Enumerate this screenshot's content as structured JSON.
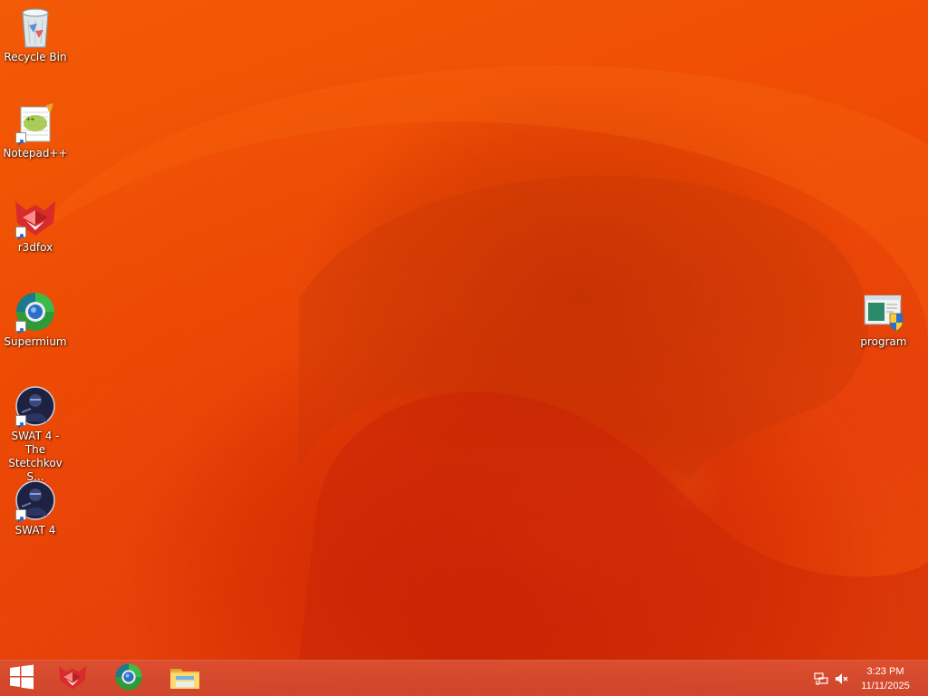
{
  "desktop": {
    "icons": [
      {
        "label": "Recycle Bin",
        "icon": "recycle-bin-icon"
      },
      {
        "label": "Notepad++",
        "icon": "notepad-plus-plus-icon"
      },
      {
        "label": "r3dfox",
        "icon": "r3dfox-icon"
      },
      {
        "label": "Supermium",
        "icon": "supermium-icon"
      },
      {
        "label": "SWAT 4 - The Stetchkov S...",
        "icon": "swat4-expansion-icon"
      },
      {
        "label": "SWAT 4",
        "icon": "swat4-icon"
      },
      {
        "label": "program",
        "icon": "program-installer-icon"
      }
    ]
  },
  "taskbar": {
    "pinned": [
      {
        "icon": "r3dfox-icon"
      },
      {
        "icon": "supermium-icon"
      },
      {
        "icon": "file-explorer-icon"
      }
    ],
    "tray": {
      "network_icon": "network-icon",
      "volume_icon": "volume-muted-icon"
    },
    "clock": {
      "time": "3:23 PM",
      "date": "11/11/2025"
    }
  },
  "colors": {
    "wallpaper": "#ef4c04",
    "taskbar": "#d65032"
  }
}
